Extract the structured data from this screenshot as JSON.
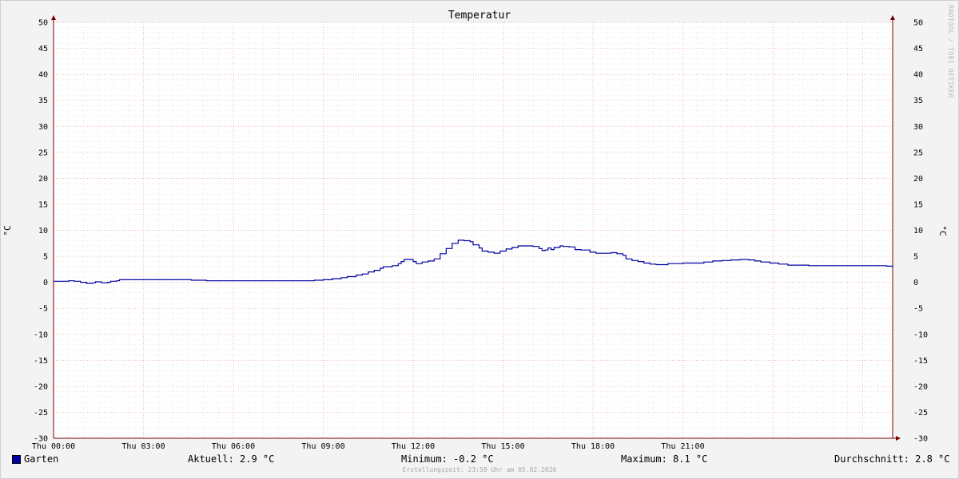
{
  "chart_data": {
    "type": "line",
    "title": "Temperatur",
    "ylabel": "°C",
    "ylabel_right": "°C",
    "ylim": [
      -30,
      50
    ],
    "y_ticks": [
      50,
      45,
      40,
      35,
      30,
      25,
      20,
      15,
      10,
      5,
      0,
      -5,
      -10,
      -15,
      -20,
      -25,
      -30
    ],
    "x_range_hours": [
      0,
      24
    ],
    "x_ticks": [
      {
        "hour": 0,
        "label": "Thu 00:00"
      },
      {
        "hour": 3,
        "label": "Thu 03:00"
      },
      {
        "hour": 6,
        "label": "Thu 06:00"
      },
      {
        "hour": 9,
        "label": "Thu 09:00"
      },
      {
        "hour": 12,
        "label": "Thu 12:00"
      },
      {
        "hour": 15,
        "label": "Thu 15:00"
      },
      {
        "hour": 18,
        "label": "Thu 18:00"
      },
      {
        "hour": 21,
        "label": "Thu 21:00"
      }
    ],
    "grid": true,
    "series": [
      {
        "name": "Garten",
        "color": "#0000a0",
        "points": [
          [
            0.0,
            0.2
          ],
          [
            0.4,
            0.2
          ],
          [
            0.5,
            0.3
          ],
          [
            0.7,
            0.2
          ],
          [
            0.8,
            0.2
          ],
          [
            0.9,
            0.0
          ],
          [
            1.1,
            -0.2
          ],
          [
            1.3,
            -0.1
          ],
          [
            1.4,
            0.1
          ],
          [
            1.6,
            -0.1
          ],
          [
            1.8,
            0.0
          ],
          [
            1.9,
            0.2
          ],
          [
            2.1,
            0.3
          ],
          [
            2.2,
            0.5
          ],
          [
            3.0,
            0.5
          ],
          [
            4.0,
            0.5
          ],
          [
            4.5,
            0.5
          ],
          [
            4.6,
            0.4
          ],
          [
            5.0,
            0.4
          ],
          [
            5.1,
            0.3
          ],
          [
            5.5,
            0.3
          ],
          [
            6.0,
            0.3
          ],
          [
            7.0,
            0.3
          ],
          [
            8.0,
            0.3
          ],
          [
            8.5,
            0.3
          ],
          [
            8.7,
            0.4
          ],
          [
            9.0,
            0.5
          ],
          [
            9.3,
            0.7
          ],
          [
            9.6,
            0.9
          ],
          [
            9.8,
            1.1
          ],
          [
            10.1,
            1.4
          ],
          [
            10.3,
            1.6
          ],
          [
            10.5,
            2.0
          ],
          [
            10.7,
            2.3
          ],
          [
            10.9,
            2.7
          ],
          [
            11.0,
            3.0
          ],
          [
            11.3,
            3.2
          ],
          [
            11.5,
            3.6
          ],
          [
            11.6,
            4.0
          ],
          [
            11.7,
            4.4
          ],
          [
            11.9,
            4.4
          ],
          [
            12.0,
            4.0
          ],
          [
            12.1,
            3.6
          ],
          [
            12.3,
            3.9
          ],
          [
            12.5,
            4.1
          ],
          [
            12.7,
            4.5
          ],
          [
            12.9,
            5.5
          ],
          [
            13.1,
            6.5
          ],
          [
            13.3,
            7.5
          ],
          [
            13.5,
            8.1
          ],
          [
            13.7,
            8.0
          ],
          [
            13.9,
            7.8
          ],
          [
            14.0,
            7.2
          ],
          [
            14.2,
            6.6
          ],
          [
            14.3,
            6.0
          ],
          [
            14.5,
            5.8
          ],
          [
            14.7,
            5.6
          ],
          [
            14.9,
            6.0
          ],
          [
            15.1,
            6.4
          ],
          [
            15.3,
            6.7
          ],
          [
            15.5,
            7.0
          ],
          [
            15.8,
            7.0
          ],
          [
            16.0,
            6.9
          ],
          [
            16.2,
            6.5
          ],
          [
            16.3,
            6.1
          ],
          [
            16.4,
            6.2
          ],
          [
            16.5,
            6.6
          ],
          [
            16.6,
            6.3
          ],
          [
            16.7,
            6.7
          ],
          [
            16.9,
            7.0
          ],
          [
            17.0,
            6.9
          ],
          [
            17.2,
            6.8
          ],
          [
            17.4,
            6.3
          ],
          [
            17.6,
            6.2
          ],
          [
            17.8,
            6.2
          ],
          [
            17.9,
            5.8
          ],
          [
            18.1,
            5.6
          ],
          [
            18.4,
            5.6
          ],
          [
            18.6,
            5.7
          ],
          [
            18.8,
            5.5
          ],
          [
            19.0,
            5.2
          ],
          [
            19.1,
            4.5
          ],
          [
            19.3,
            4.2
          ],
          [
            19.5,
            4.0
          ],
          [
            19.7,
            3.7
          ],
          [
            19.9,
            3.5
          ],
          [
            20.1,
            3.4
          ],
          [
            20.3,
            3.4
          ],
          [
            20.5,
            3.6
          ],
          [
            21.0,
            3.7
          ],
          [
            21.5,
            3.7
          ],
          [
            21.7,
            3.9
          ],
          [
            22.0,
            4.1
          ],
          [
            22.3,
            4.2
          ],
          [
            22.6,
            4.3
          ],
          [
            22.9,
            4.4
          ],
          [
            23.2,
            4.3
          ],
          [
            23.4,
            4.1
          ],
          [
            23.6,
            3.9
          ],
          [
            23.9,
            3.7
          ],
          [
            24.2,
            3.5
          ],
          [
            24.5,
            3.3
          ],
          [
            24.8,
            3.3
          ],
          [
            25.2,
            3.2
          ],
          [
            26.0,
            3.2
          ],
          [
            27.0,
            3.2
          ],
          [
            27.5,
            3.2
          ],
          [
            27.8,
            3.1
          ],
          [
            28.0,
            2.9
          ]
        ]
      }
    ],
    "x_end_hour": 28.0
  },
  "legend": {
    "series_name": "Garten",
    "swatch_color": "#0000a0",
    "current": "Aktuell: 2.9 °C",
    "minimum": "Minimum: -0.2 °C",
    "maximum": "Maximum: 8.1 °C",
    "average": "Durchschnitt: 2.8 °C"
  },
  "watermark": "RRDTOOL / TOBI OETIKER",
  "footer": "Erstellungszeit: 23:58 Uhr am 05.02.2026"
}
